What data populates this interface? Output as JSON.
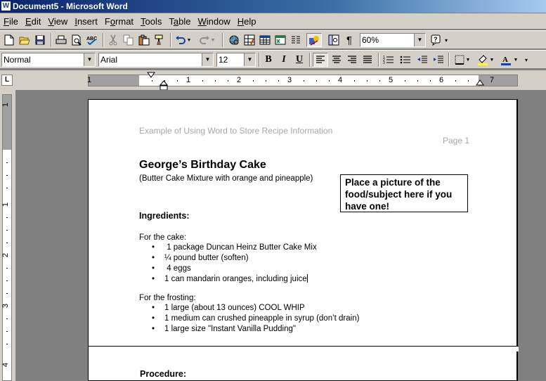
{
  "window": {
    "title": "Document5 - Microsoft Word",
    "icon": "W"
  },
  "menu": [
    "File",
    "Edit",
    "View",
    "Insert",
    "Format",
    "Tools",
    "Table",
    "Window",
    "Help"
  ],
  "menu_underline": [
    "F",
    "E",
    "V",
    "I",
    "o",
    "T",
    "a",
    "W",
    "H"
  ],
  "toolbar": {
    "zoom": "60%"
  },
  "formatting": {
    "style": "Normal",
    "font": "Arial",
    "size": "12"
  },
  "ruler": {
    "tab_selector": "L",
    "h_numbers": [
      "1",
      "1",
      "2",
      "3",
      "4",
      "5",
      "6",
      "7"
    ],
    "v_numbers": [
      "1",
      "1",
      "2",
      "3",
      "4"
    ]
  },
  "document": {
    "header_text": "Example of Using Word to Store Recipe Information",
    "header_page": "Page   1",
    "title": "George’s Birthday Cake",
    "subtitle": "(Butter Cake Mixture with orange and pineapple)",
    "picture_box": "Place a picture of the food/subject here if you have one!",
    "ingredients_head": "Ingredients:",
    "cake_label": "For the cake:",
    "cake_items": [
      " 1 package Duncan Heinz Butter Cake Mix",
      "¼ pound butter (soften)",
      " 4 eggs",
      "1 can mandarin oranges, including juice"
    ],
    "frosting_label": "For the frosting:",
    "frosting_items": [
      "1 large (about 13 ounces) COOL WHIP",
      "1 medium can crushed pineapple in syrup (don’t drain)",
      "1 large size \"Instant Vanilla Pudding\""
    ],
    "procedure_head": "Procedure:"
  }
}
